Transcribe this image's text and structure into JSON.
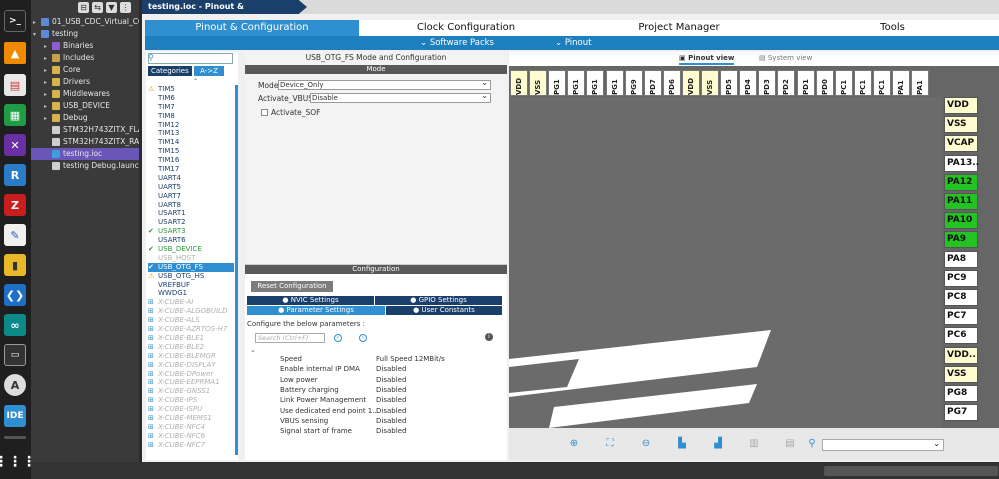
{
  "window": {
    "title": "testing.ioc - Pinout & Configuration"
  },
  "explorer": {
    "items": [
      {
        "label": "01_USB_CDC_Virtual_CO",
        "depth": 0,
        "arrow": "▸",
        "icon": "project-icon",
        "selected": false
      },
      {
        "label": "testing",
        "depth": 0,
        "arrow": "▾",
        "icon": "project-icon",
        "selected": false
      },
      {
        "label": "Binaries",
        "depth": 1,
        "arrow": "▸",
        "icon": "binaries-icon",
        "selected": false
      },
      {
        "label": "Includes",
        "depth": 1,
        "arrow": "▸",
        "icon": "includes-icon",
        "selected": false
      },
      {
        "label": "Core",
        "depth": 1,
        "arrow": "▸",
        "icon": "folder-icon",
        "selected": false
      },
      {
        "label": "Drivers",
        "depth": 1,
        "arrow": "▸",
        "icon": "folder-icon",
        "selected": false
      },
      {
        "label": "Middlewares",
        "depth": 1,
        "arrow": "▸",
        "icon": "folder-icon",
        "selected": false
      },
      {
        "label": "USB_DEVICE",
        "depth": 1,
        "arrow": "▸",
        "icon": "folder-icon",
        "selected": false
      },
      {
        "label": "Debug",
        "depth": 1,
        "arrow": "▸",
        "icon": "folder-icon",
        "selected": false
      },
      {
        "label": "STM32H743ZITX_FLA",
        "depth": 1,
        "arrow": "",
        "icon": "file-icon",
        "selected": false
      },
      {
        "label": "STM32H743ZITX_RAM",
        "depth": 1,
        "arrow": "",
        "icon": "file-icon",
        "selected": false
      },
      {
        "label": "testing.ioc",
        "depth": 1,
        "arrow": "",
        "icon": "ioc-file-icon",
        "selected": true
      },
      {
        "label": "testing Debug.launch",
        "depth": 1,
        "arrow": "",
        "icon": "file-icon",
        "selected": false
      }
    ]
  },
  "nav": {
    "tabs": [
      "Pinout & Configuration",
      "Clock Configuration",
      "Project Manager",
      "Tools"
    ],
    "sub": [
      "Software Packs",
      "Pinout"
    ]
  },
  "left": {
    "categories": "Categories",
    "az": "A->Z",
    "items": [
      {
        "label": "TIM5",
        "state": "warn"
      },
      {
        "label": "TIM6",
        "state": ""
      },
      {
        "label": "TIM7",
        "state": ""
      },
      {
        "label": "TIM8",
        "state": ""
      },
      {
        "label": "TIM12",
        "state": ""
      },
      {
        "label": "TIM13",
        "state": ""
      },
      {
        "label": "TIM14",
        "state": ""
      },
      {
        "label": "TIM15",
        "state": ""
      },
      {
        "label": "TIM16",
        "state": ""
      },
      {
        "label": "TIM17",
        "state": ""
      },
      {
        "label": "UART4",
        "state": ""
      },
      {
        "label": "UART5",
        "state": ""
      },
      {
        "label": "UART7",
        "state": ""
      },
      {
        "label": "UART8",
        "state": ""
      },
      {
        "label": "USART1",
        "state": ""
      },
      {
        "label": "USART2",
        "state": ""
      },
      {
        "label": "USART3",
        "state": "ok"
      },
      {
        "label": "USART6",
        "state": ""
      },
      {
        "label": "USB_DEVICE",
        "state": "ok"
      },
      {
        "label": "USB_HOST",
        "state": "dis"
      },
      {
        "label": "USB_OTG_FS",
        "state": "sel"
      },
      {
        "label": "USB_OTG_HS",
        "state": "warn"
      },
      {
        "label": "VREFBUF",
        "state": ""
      },
      {
        "label": "WWDG1",
        "state": ""
      },
      {
        "label": "X-CUBE-AI",
        "state": "x"
      },
      {
        "label": "X-CUBE-ALGOBUILD",
        "state": "x"
      },
      {
        "label": "X-CUBE-ALS",
        "state": "x"
      },
      {
        "label": "X-CUBE-AZRTOS-H7",
        "state": "x"
      },
      {
        "label": "X-CUBE-BLE1",
        "state": "x"
      },
      {
        "label": "X-CUBE-BLE2",
        "state": "x"
      },
      {
        "label": "X-CUBE-BLEMGR",
        "state": "x"
      },
      {
        "label": "X-CUBE-DISPLAY",
        "state": "x"
      },
      {
        "label": "X-CUBE-DPower",
        "state": "x"
      },
      {
        "label": "X-CUBE-EEPRMA1",
        "state": "x"
      },
      {
        "label": "X-CUBE-GNSS1",
        "state": "x"
      },
      {
        "label": "X-CUBE-IPS",
        "state": "x"
      },
      {
        "label": "X-CUBE-ISPU",
        "state": "x"
      },
      {
        "label": "X-CUBE-MEMS1",
        "state": "x"
      },
      {
        "label": "X-CUBE-NFC4",
        "state": "x"
      },
      {
        "label": "X-CUBE-NFC6",
        "state": "x"
      },
      {
        "label": "X-CUBE-NFC7",
        "state": "x"
      }
    ]
  },
  "mode": {
    "panel_title": "USB_OTG_FS Mode and Configuration",
    "header": "Mode",
    "mode_label": "Mode",
    "mode_value": "Device_Only",
    "vbus_label": "Activate_VBUS",
    "vbus_value": "Disable",
    "sof_label": "Activate_SOF"
  },
  "config": {
    "header": "Configuration",
    "reset": "Reset Configuration",
    "tabs": [
      "NVIC Settings",
      "GPIO Settings",
      "Parameter Settings",
      "User Constants"
    ],
    "below": "Configure the below parameters :",
    "search_placeholder": "Search (Ctrl+F)",
    "params": [
      {
        "name": "Speed",
        "value": "Full Speed 12MBit/s"
      },
      {
        "name": "Enable internal IP DMA",
        "value": "Disabled"
      },
      {
        "name": "Low power",
        "value": "Disabled"
      },
      {
        "name": "Battery charging",
        "value": "Disabled"
      },
      {
        "name": "Link Power Management",
        "value": "Disabled"
      },
      {
        "name": "Use dedicated end point 1...",
        "value": "Disabled"
      },
      {
        "name": "VBUS sensing",
        "value": "Disabled"
      },
      {
        "name": "Signal start of frame",
        "value": "Disabled"
      }
    ]
  },
  "pinout": {
    "view_label": "Pinout view",
    "system_label": "System view",
    "top_pins": [
      {
        "label": "VDD",
        "color": "yellow"
      },
      {
        "label": "VSS",
        "color": "yellow"
      },
      {
        "label": "PG1",
        "color": "white"
      },
      {
        "label": "PG1",
        "color": "white"
      },
      {
        "label": "PG1",
        "color": "white"
      },
      {
        "label": "PG1",
        "color": "white"
      },
      {
        "label": "PG9",
        "color": "white"
      },
      {
        "label": "PD7",
        "color": "white"
      },
      {
        "label": "PD6",
        "color": "white"
      },
      {
        "label": "VDD",
        "color": "yellow"
      },
      {
        "label": "VSS",
        "color": "yellow"
      },
      {
        "label": "PD5",
        "color": "white"
      },
      {
        "label": "PD4",
        "color": "white"
      },
      {
        "label": "PD3",
        "color": "white"
      },
      {
        "label": "PD2",
        "color": "white"
      },
      {
        "label": "PD1",
        "color": "white"
      },
      {
        "label": "PD0",
        "color": "white"
      },
      {
        "label": "PC1",
        "color": "white"
      },
      {
        "label": "PC1",
        "color": "white"
      },
      {
        "label": "PC1",
        "color": "white"
      },
      {
        "label": "PA1",
        "color": "white"
      },
      {
        "label": "PA1",
        "color": "white"
      }
    ],
    "right_pins": [
      {
        "label": "VDD",
        "color": "yellow"
      },
      {
        "label": "VSS",
        "color": "yellow"
      },
      {
        "label": "VCAP",
        "color": "yellow"
      },
      {
        "label": "PA13..",
        "color": "white"
      },
      {
        "label": "PA12",
        "color": "green"
      },
      {
        "label": "PA11",
        "color": "green"
      },
      {
        "label": "PA10",
        "color": "green"
      },
      {
        "label": "PA9",
        "color": "green"
      },
      {
        "label": "PA8",
        "color": "white"
      },
      {
        "label": "PC9",
        "color": "white"
      },
      {
        "label": "PC8",
        "color": "white"
      },
      {
        "label": "PC7",
        "color": "white"
      },
      {
        "label": "PC6",
        "color": "white"
      },
      {
        "label": "VDD..",
        "color": "yellow"
      },
      {
        "label": "VSS",
        "color": "yellow"
      },
      {
        "label": "PG8",
        "color": "white"
      },
      {
        "label": "PG7",
        "color": "white"
      }
    ],
    "colors": {
      "yellow": "#fffcd0",
      "green": "#22c322",
      "white": "#ffffff"
    }
  }
}
